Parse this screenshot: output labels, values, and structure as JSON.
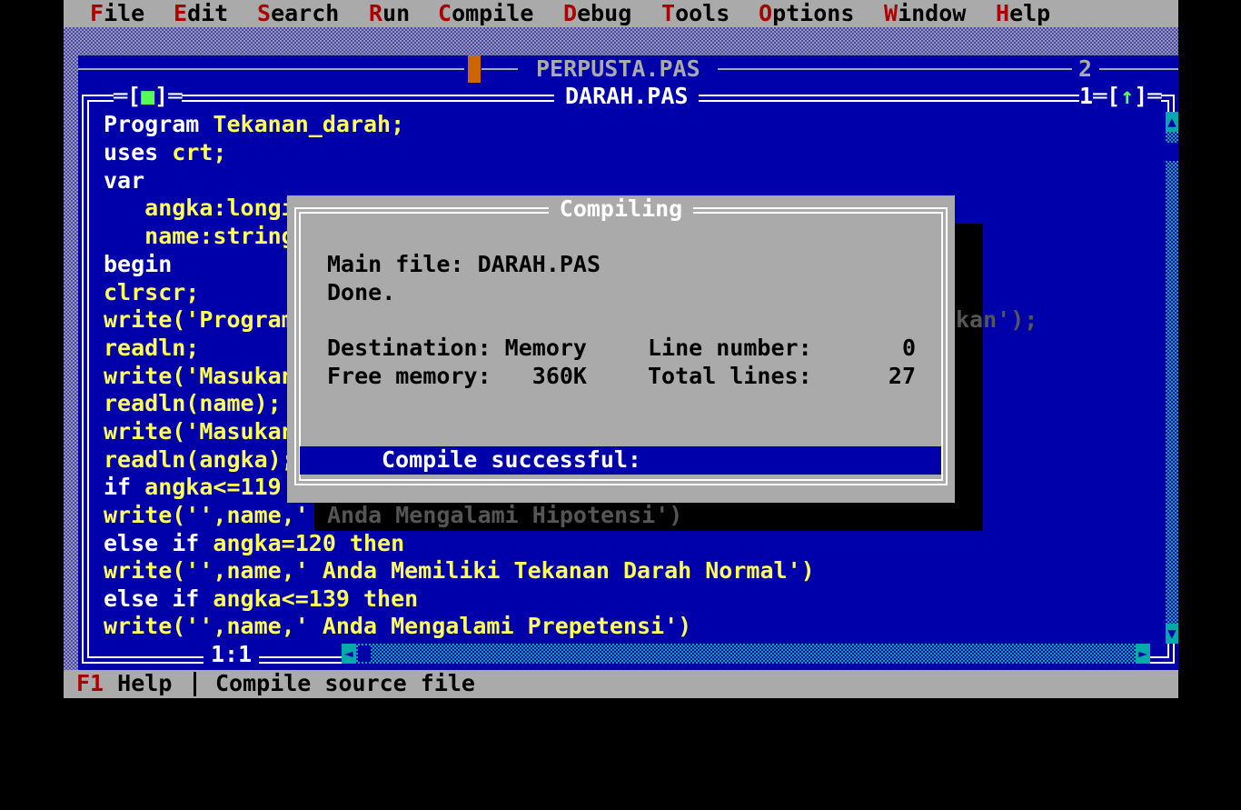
{
  "menu": {
    "items": [
      {
        "hot": "F",
        "rest": "ile"
      },
      {
        "hot": "E",
        "rest": "dit"
      },
      {
        "hot": "S",
        "rest": "earch"
      },
      {
        "hot": "R",
        "rest": "un"
      },
      {
        "hot": "C",
        "rest": "ompile"
      },
      {
        "hot": "D",
        "rest": "ebug"
      },
      {
        "hot": "T",
        "rest": "ools"
      },
      {
        "hot": "O",
        "rest": "ptions"
      },
      {
        "hot": "W",
        "rest": "indow"
      },
      {
        "hot": "H",
        "rest": "elp"
      }
    ]
  },
  "windows": {
    "back": {
      "title": "PERPUSTA.PAS",
      "number": "2"
    },
    "front": {
      "title": "DARAH.PAS",
      "number": "1",
      "close": "■",
      "zoom": "↑",
      "cursor_pos": "1:1"
    }
  },
  "editor": {
    "lines": [
      {
        "a": "Program ",
        "b": "Tekanan_darah;"
      },
      {
        "a": "uses ",
        "b": "crt;"
      },
      {
        "a": "var",
        "b": ""
      },
      {
        "a": "",
        "b": "   angka:longint;"
      },
      {
        "a": "",
        "b": "   name:string;"
      },
      {
        "a": "begin",
        "b": ""
      },
      {
        "a": "",
        "b": "clrscr;"
      },
      {
        "a": "",
        "b": "write('Program Mengetahui Tekanan Darah Masukkan');"
      },
      {
        "a": "",
        "b": "readln;"
      },
      {
        "a": "",
        "b": "write('Masukan Nama Anda: ');"
      },
      {
        "a": "",
        "b": "readln(name);"
      },
      {
        "a": "",
        "b": "write('Masukan Tekanan Darah Anda: ');"
      },
      {
        "a": "",
        "b": "readln(angka);"
      },
      {
        "a": "if ",
        "b": "angka<=119 then"
      },
      {
        "a": "",
        "b": "write('',name,' Anda Mengalami Hipotensi')"
      },
      {
        "a": "else if ",
        "b": "angka=120 then"
      },
      {
        "a": "",
        "b": "write('',name,' Anda Memiliki Tekanan Darah Normal')"
      },
      {
        "a": "else if ",
        "b": "angka<=139 then"
      },
      {
        "a": "",
        "b": "write('',name,' Anda Mengalami Prepetensi')"
      }
    ],
    "visible_tail_7": "kan');",
    "visible_tail_14": "Anda Mengalami Hipotensi')"
  },
  "dialog": {
    "title": "Compiling",
    "main_file": "Main file: DARAH.PAS",
    "done": "Done.",
    "destination_label": "Destination: Memory",
    "free_memory_label": "Free memory:   360K",
    "line_number_label": "Line number:",
    "line_number_value": "0",
    "total_lines_label": "Total lines:",
    "total_lines_value": "27",
    "status": "Compile successful:"
  },
  "statusbar": {
    "f1_key": "F1",
    "f1_label": " Help",
    "hint": "Compile source file"
  },
  "colors": {
    "desktop_blue": "#0000aa",
    "menu_gray": "#aaaaaa",
    "hotkey_red": "#aa0000",
    "code_yellow": "#ffff55",
    "accent_green": "#55ff55"
  }
}
